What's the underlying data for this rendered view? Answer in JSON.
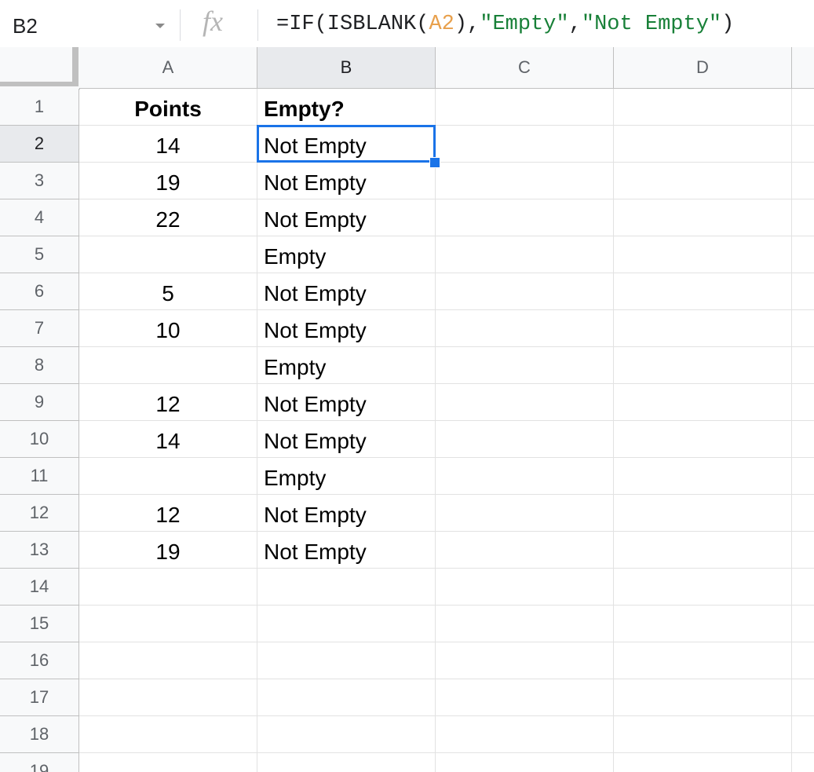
{
  "name_box": {
    "cell_ref": "B2"
  },
  "formula_bar": {
    "fx_label": "fx",
    "formula_parts": [
      {
        "text": "=IF(ISBLANK(",
        "kind": "plain"
      },
      {
        "text": "A2",
        "kind": "ref"
      },
      {
        "text": "),",
        "kind": "plain"
      },
      {
        "text": "\"Empty\"",
        "kind": "str"
      },
      {
        "text": ",",
        "kind": "plain"
      },
      {
        "text": "\"Not Empty\"",
        "kind": "str"
      },
      {
        "text": ")",
        "kind": "plain"
      }
    ]
  },
  "columns": [
    "A",
    "B",
    "C",
    "D"
  ],
  "active_column": "B",
  "active_row": "2",
  "rows": [
    {
      "n": "1",
      "a": "Points",
      "b": "Empty?"
    },
    {
      "n": "2",
      "a": "14",
      "b": "Not Empty"
    },
    {
      "n": "3",
      "a": "19",
      "b": "Not Empty"
    },
    {
      "n": "4",
      "a": "22",
      "b": "Not Empty"
    },
    {
      "n": "5",
      "a": "",
      "b": "Empty"
    },
    {
      "n": "6",
      "a": "5",
      "b": "Not Empty"
    },
    {
      "n": "7",
      "a": "10",
      "b": "Not Empty"
    },
    {
      "n": "8",
      "a": "",
      "b": "Empty"
    },
    {
      "n": "9",
      "a": "12",
      "b": "Not Empty"
    },
    {
      "n": "10",
      "a": "14",
      "b": "Not Empty"
    },
    {
      "n": "11",
      "a": "",
      "b": "Empty"
    },
    {
      "n": "12",
      "a": "12",
      "b": "Not Empty"
    },
    {
      "n": "13",
      "a": "19",
      "b": "Not Empty"
    },
    {
      "n": "14",
      "a": "",
      "b": ""
    },
    {
      "n": "15",
      "a": "",
      "b": ""
    },
    {
      "n": "16",
      "a": "",
      "b": ""
    },
    {
      "n": "17",
      "a": "",
      "b": ""
    },
    {
      "n": "18",
      "a": "",
      "b": ""
    },
    {
      "n": "19",
      "a": "",
      "b": ""
    }
  ],
  "colors": {
    "selection": "#1a73e8",
    "formula_ref": "#e8a04c",
    "formula_string": "#188038"
  }
}
